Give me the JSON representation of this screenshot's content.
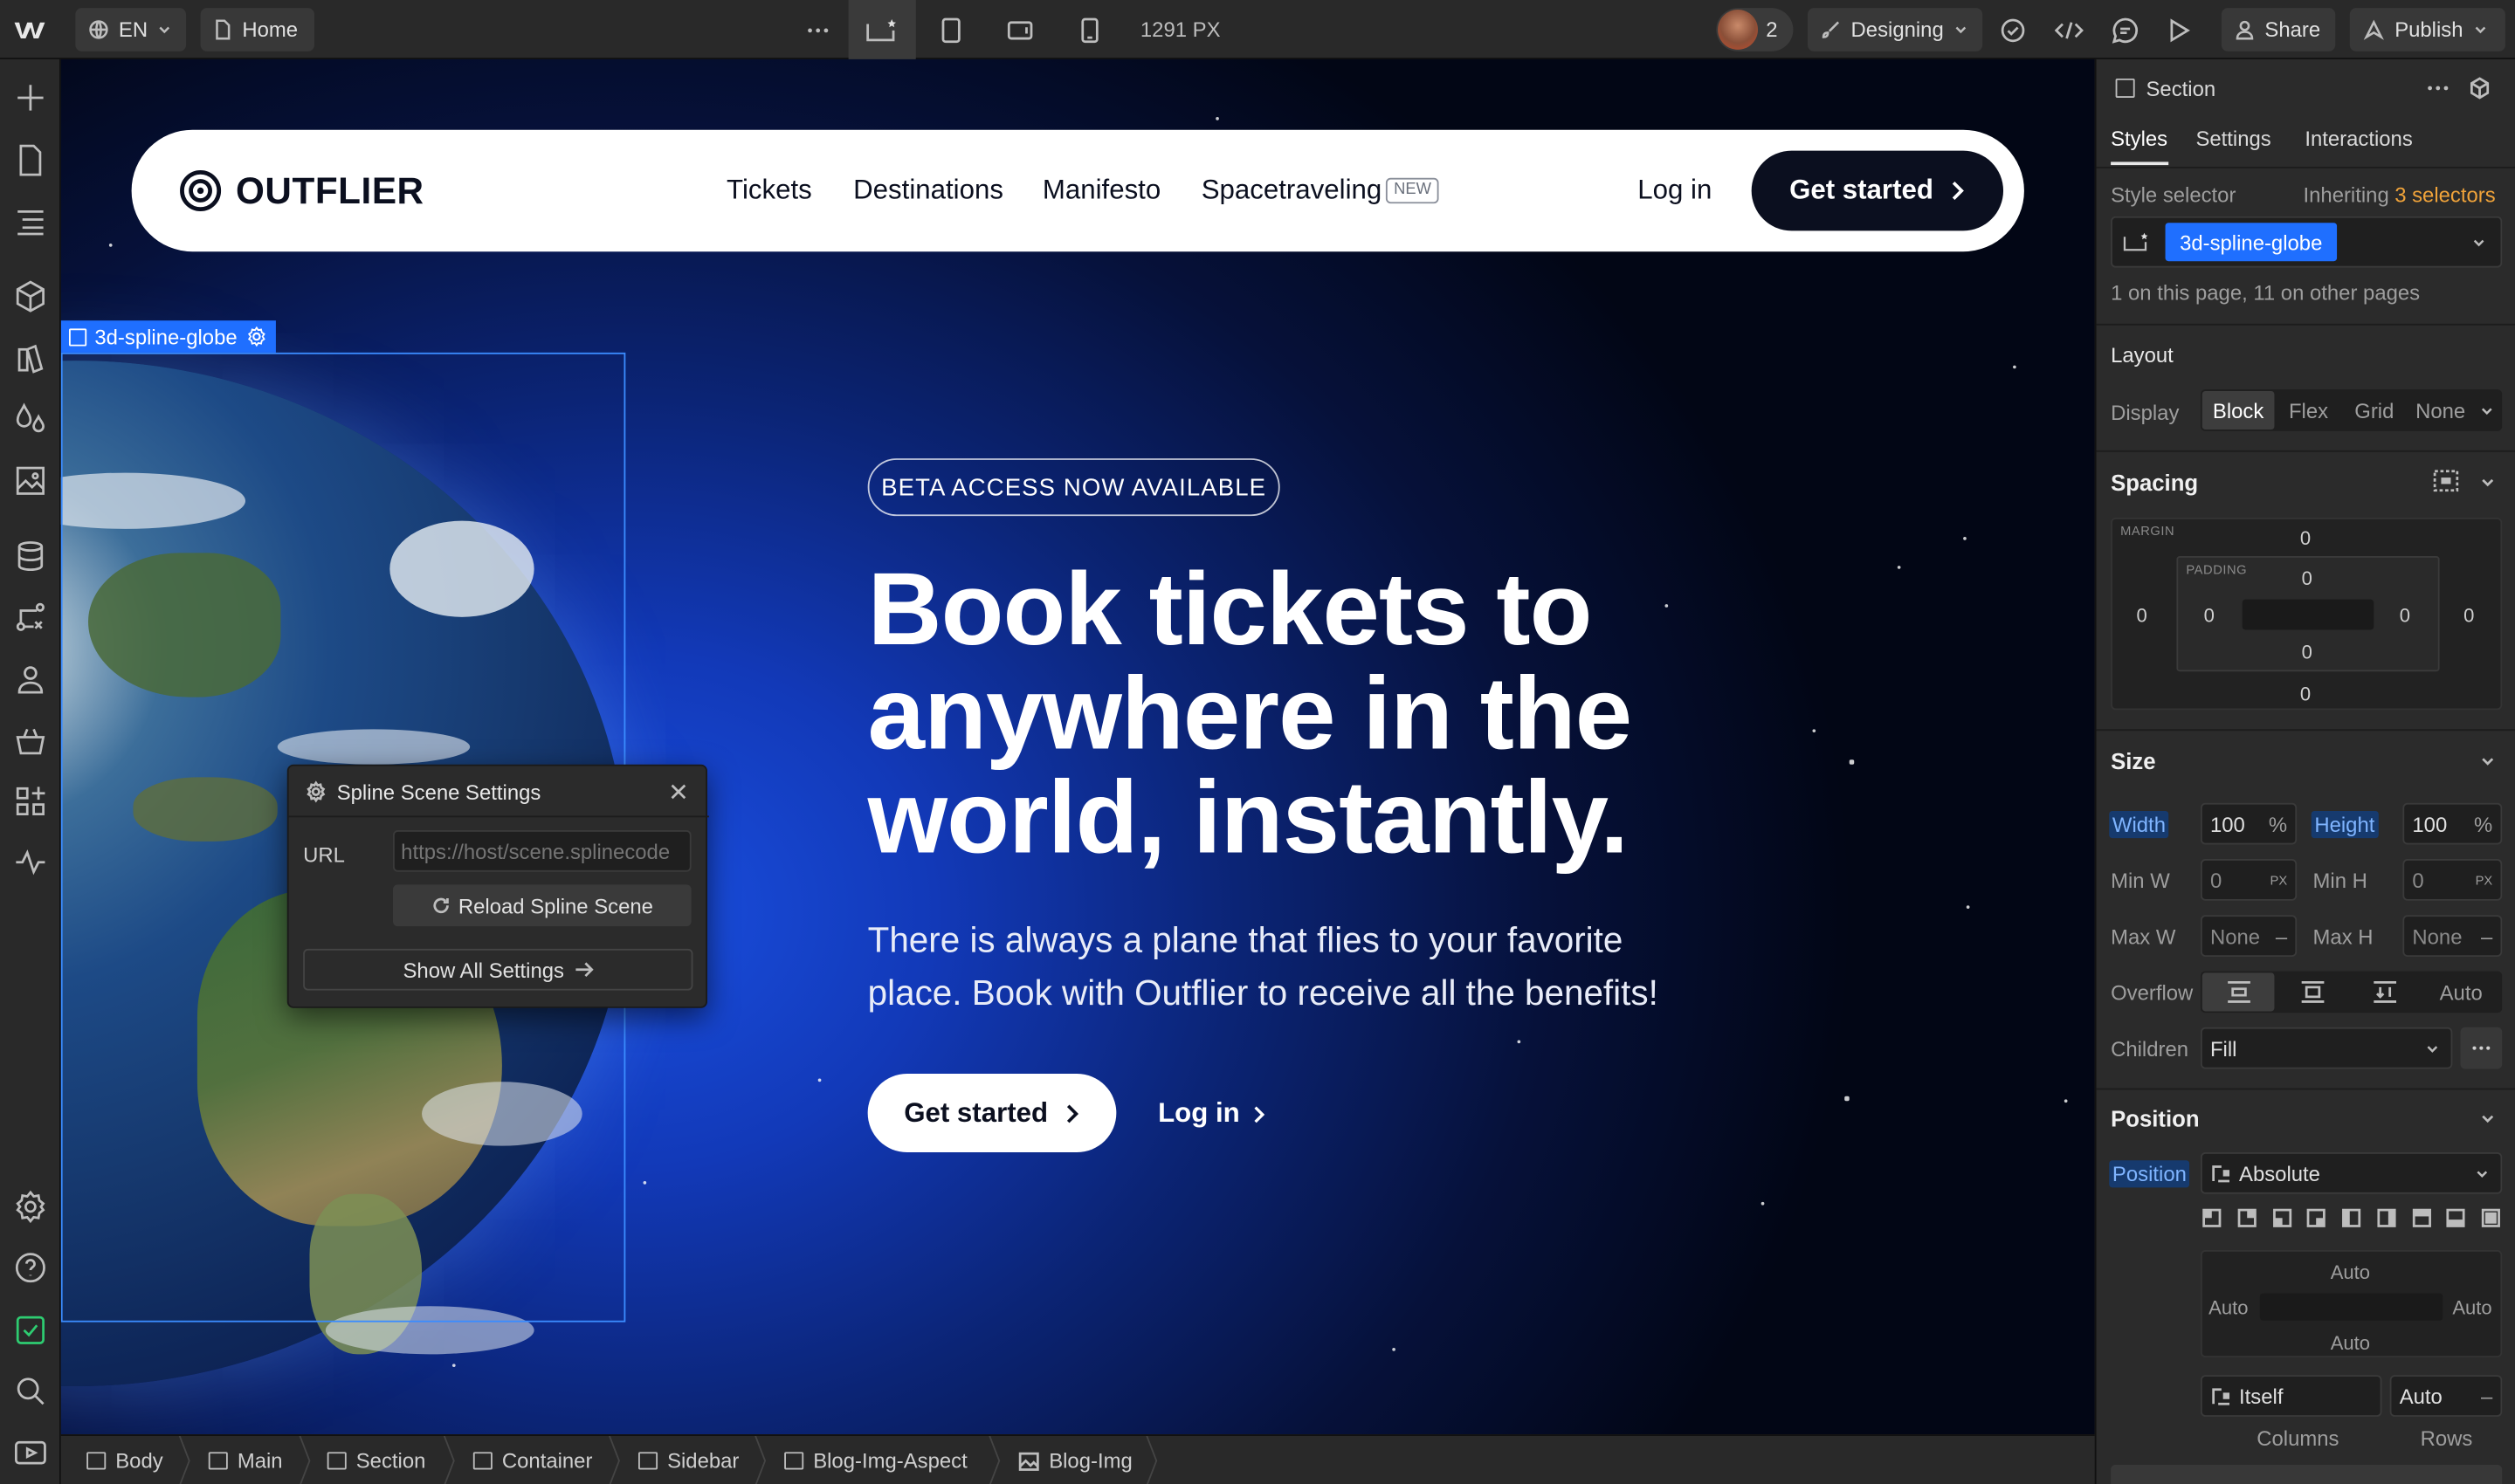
{
  "topbar": {
    "logo": "webflow-logo",
    "locale": "EN",
    "page": "Home",
    "width_readout": "1291 PX",
    "collaborators_count": "2",
    "mode": "Designing",
    "share": "Share",
    "publish": "Publish"
  },
  "selection": {
    "label": "3d-spline-globe"
  },
  "site": {
    "brand": "OUTFLIER",
    "nav": [
      "Tickets",
      "Destinations",
      "Manifesto",
      "Spacetraveling"
    ],
    "nav_badge": "NEW",
    "login": "Log in",
    "cta": "Get started",
    "beta": "BETA ACCESS NOW AVAILABLE",
    "headline": [
      "Book tickets to",
      "anywhere in the",
      "world, instantly."
    ],
    "subtext": [
      "There is always a plane that flies to your favorite",
      "place. Book with Outflier to receive all the benefits!"
    ],
    "hero_cta": "Get started",
    "hero_login": "Log in"
  },
  "spline_popup": {
    "title": "Spline Scene Settings",
    "url_label": "URL",
    "url_placeholder": "https://host/scene.splinecode",
    "reload": "Reload Spline Scene",
    "show_all": "Show All Settings"
  },
  "panel": {
    "element": "Section",
    "tabs": [
      "Styles",
      "Settings",
      "Interactions"
    ],
    "style_selector": "Style selector",
    "inheriting": "Inheriting",
    "selectors": "3 selectors",
    "class_chip": "3d-spline-globe",
    "usage": "1 on this page, 11 on other pages",
    "layout": {
      "title": "Layout",
      "display_label": "Display",
      "options": [
        "Block",
        "Flex",
        "Grid",
        "None"
      ]
    },
    "spacing": {
      "title": "Spacing",
      "margin_label": "MARGIN",
      "padding_label": "PADDING",
      "margin": {
        "top": "0",
        "right": "0",
        "bottom": "0",
        "left": "0"
      },
      "padding": {
        "top": "0",
        "right": "0",
        "bottom": "0",
        "left": "0"
      }
    },
    "size": {
      "title": "Size",
      "width_label": "Width",
      "width_value": "100",
      "width_unit": "%",
      "height_label": "Height",
      "height_value": "100",
      "height_unit": "%",
      "minw_label": "Min W",
      "minw_value": "0",
      "minw_unit": "PX",
      "minh_label": "Min H",
      "minh_value": "0",
      "minh_unit": "PX",
      "maxw_label": "Max W",
      "maxw_value": "None",
      "maxh_label": "Max H",
      "maxh_value": "None",
      "dash": "–",
      "overflow_label": "Overflow",
      "overflow_auto": "Auto",
      "children_label": "Children",
      "children_value": "Fill"
    },
    "position": {
      "title": "Position",
      "label": "Position",
      "value": "Absolute",
      "top": "Auto",
      "left": "Auto",
      "right": "Auto",
      "bottom": "Auto",
      "relative_to": "Itself",
      "zindex": "Auto",
      "columns": "Columns",
      "rows": "Rows"
    }
  },
  "breadcrumbs": [
    "Body",
    "Main",
    "Section",
    "Container",
    "Sidebar",
    "Blog-Img-Aspect",
    "Blog-Img"
  ],
  "colors": {
    "accent": "#1f6fff",
    "nav_dark": "#0b0f1f",
    "panel_bg": "#2b2b2b"
  }
}
